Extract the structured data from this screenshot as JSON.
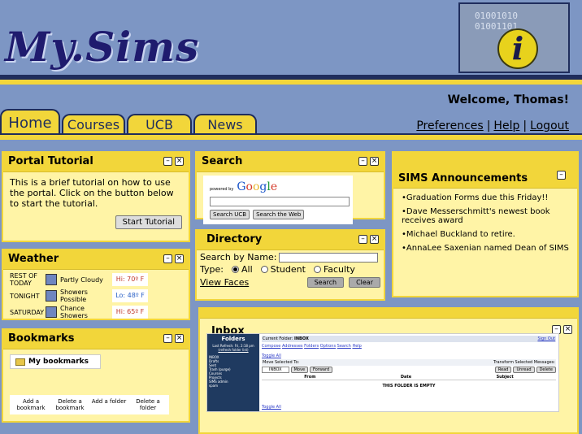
{
  "header": {
    "logo": "My.Sims",
    "info_bits": [
      "01001010",
      "01001101"
    ],
    "info_icon": "i",
    "welcome": "Welcome, Thomas!",
    "links": [
      "Preferences",
      "Help",
      "Logout"
    ]
  },
  "tabs": [
    "Home",
    "Courses",
    "UCB",
    "News"
  ],
  "colors": {
    "accent": "#f2d63a",
    "panel": "#fff4a6",
    "bg": "#7d96c4",
    "navy": "#1f2d5c"
  },
  "portal_tutorial": {
    "title": "Portal Tutorial",
    "text": "This is a brief tutorial on how to use the portal. Click on the button below to start the tutorial.",
    "button": "Start Tutorial"
  },
  "weather": {
    "title": "Weather",
    "rows": [
      {
        "day": "REST OF TODAY",
        "cond": "Partly Cloudy",
        "temp": "Hi: 70º F",
        "kind": "hi"
      },
      {
        "day": "TONIGHT",
        "cond": "Showers Possible",
        "temp": "Lo: 48º F",
        "kind": "lo"
      },
      {
        "day": "SATURDAY",
        "cond": "Chance Showers",
        "temp": "Hi: 65º F",
        "kind": "hi"
      }
    ]
  },
  "bookmarks": {
    "title": "Bookmarks",
    "folder": "My bookmarks",
    "actions": [
      "Add a bookmark",
      "Delete a bookmark",
      "Add a folder",
      "Delete a folder"
    ]
  },
  "search": {
    "title": "Search",
    "powered": "powered by",
    "logo": [
      "G",
      "o",
      "o",
      "g",
      "l",
      "e"
    ],
    "buttons": [
      "Search UCB",
      "Search the Web"
    ]
  },
  "directory": {
    "title": "Directory",
    "search_label": "Search by Name:",
    "type_label": "Type:",
    "options": [
      "All",
      "Student",
      "Faculty"
    ],
    "view_faces": "View Faces",
    "search_btn": "Search",
    "clear_btn": "Clear"
  },
  "announcements": {
    "title": "SIMS Announcements",
    "items": [
      "•Graduation Forms due this Friday!!",
      "•Dave Messerschmitt's newest book receives award",
      "•Michael Buckland to retire.",
      "•AnnaLee Saxenian named Dean of SIMS"
    ]
  },
  "inbox": {
    "title": "Inbox",
    "folders_title": "Folders",
    "last_refresh": "Last Refresh: Fri, 2:18 pm",
    "refresh_link": "(refresh folder list)",
    "folders": [
      "INBOX",
      "Drafts",
      "Sent",
      "Trash (purge)",
      "Courses",
      "Projects",
      "SIMS admin",
      "spam"
    ],
    "current_folder_label": "Current Folder:",
    "current_folder": "INBOX",
    "sign_out": "Sign Out",
    "menu": [
      "Compose",
      "Addresses",
      "Folders",
      "Options",
      "Search",
      "Help"
    ],
    "toggle_all": "Toggle All",
    "move_selected": "Move Selected To:",
    "transform": "Transform Selected Messages:",
    "select_value": "INBOX",
    "move_btn": "Move",
    "forward_btn": "Forward",
    "read_btn": "Read",
    "unread_btn": "Unread",
    "delete_btn": "Delete",
    "columns": [
      "From",
      "Date",
      "Subject"
    ],
    "empty": "THIS FOLDER IS EMPTY"
  }
}
